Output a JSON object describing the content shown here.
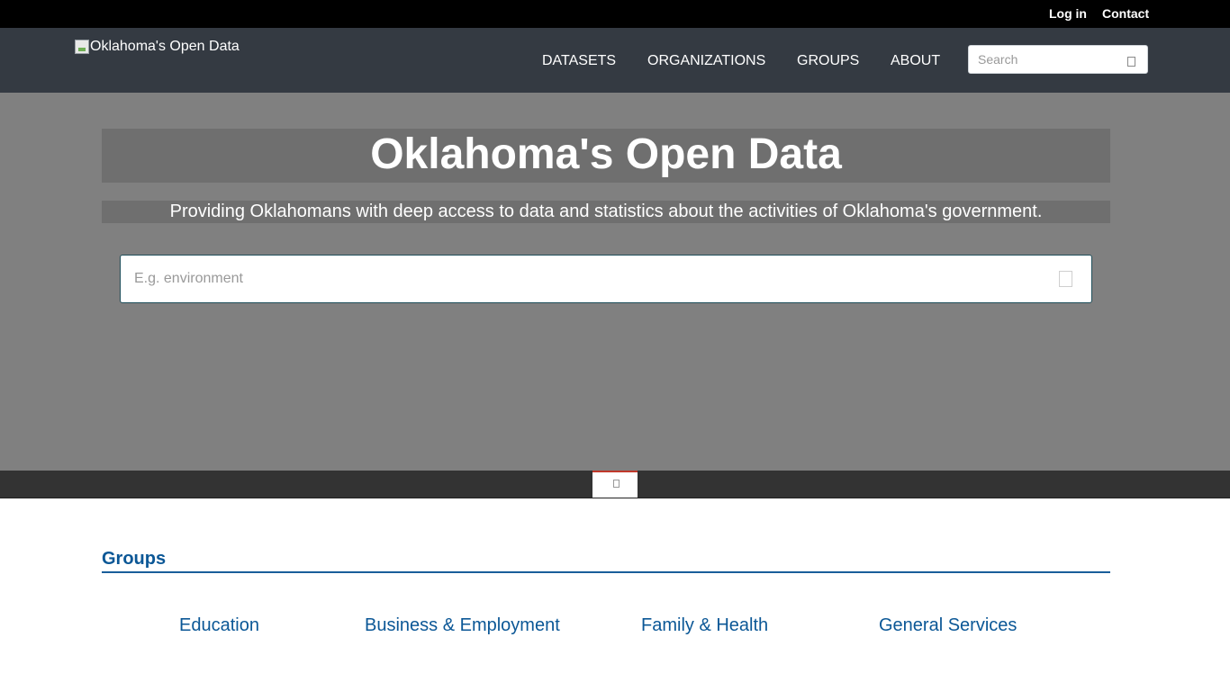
{
  "topbar": {
    "login_label": "Log in",
    "contact_label": "Contact"
  },
  "header": {
    "logo_alt": "Oklahoma's Open Data",
    "nav": {
      "datasets": "DATASETS",
      "organizations": "ORGANIZATIONS",
      "groups": "GROUPS",
      "about": "ABOUT"
    },
    "search_placeholder": "Search",
    "search_icon": "search-icon"
  },
  "hero": {
    "title": "Oklahoma's Open Data",
    "subtitle": "Providing Oklahomans with deep access to data and statistics about the activities of Oklahoma's government.",
    "search_placeholder": "E.g. environment",
    "search_icon": "search-icon"
  },
  "tabstrip": {
    "toggle_icon": "chevron-icon",
    "accent_color": "#c0392b"
  },
  "groups": {
    "heading": "Groups",
    "items": [
      {
        "label": "Education"
      },
      {
        "label": "Business & Employment"
      },
      {
        "label": "Family & Health"
      },
      {
        "label": "General Services"
      }
    ]
  },
  "colors": {
    "topbar_bg": "#000000",
    "navbar_bg": "#343a42",
    "hero_bg": "#808080",
    "link_blue": "#0b5796"
  }
}
